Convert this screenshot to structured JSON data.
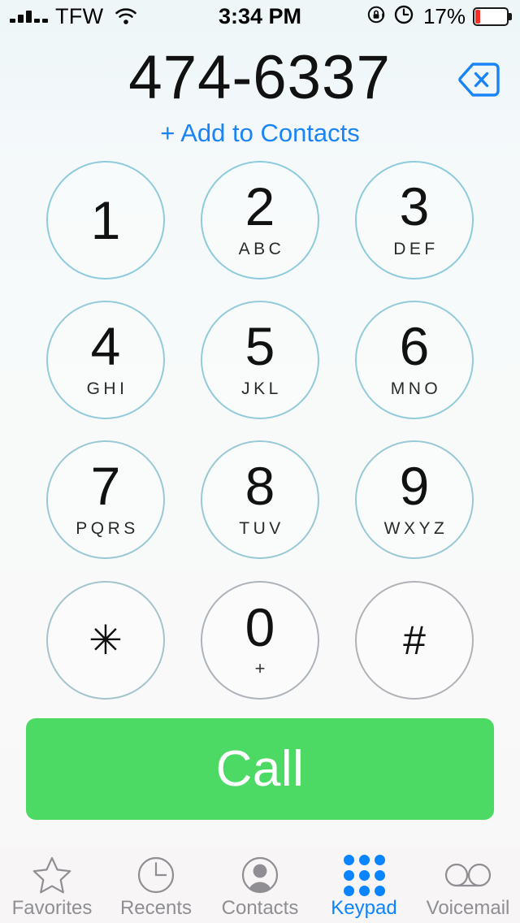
{
  "status_bar": {
    "carrier": "TFW",
    "signal_icon": "signal-bars-icon",
    "signal_bars_filled": 2,
    "signal_bars_total": 5,
    "wifi_icon": "wifi-icon",
    "time": "3:34 PM",
    "rotation_lock_icon": "rotation-lock-icon",
    "alarm_icon": "alarm-clock-icon",
    "battery_percent": "17%",
    "battery_level": 17,
    "battery_color": "#f52f23",
    "battery_icon": "battery-icon"
  },
  "display": {
    "phone_number": "474-6337",
    "add_to_contacts_label": "+ Add to Contacts",
    "add_to_contacts_color": "#1a84f7",
    "delete_icon": "delete-backspace-icon"
  },
  "keypad": {
    "rows": [
      [
        {
          "digit": "1",
          "letters": ""
        },
        {
          "digit": "2",
          "letters": "ABC"
        },
        {
          "digit": "3",
          "letters": "DEF"
        }
      ],
      [
        {
          "digit": "4",
          "letters": "GHI"
        },
        {
          "digit": "5",
          "letters": "JKL"
        },
        {
          "digit": "6",
          "letters": "MNO"
        }
      ],
      [
        {
          "digit": "7",
          "letters": "PQRS"
        },
        {
          "digit": "8",
          "letters": "TUV"
        },
        {
          "digit": "9",
          "letters": "WXYZ"
        }
      ],
      [
        {
          "digit": "✳",
          "letters": ""
        },
        {
          "digit": "0",
          "letters": "+"
        },
        {
          "digit": "#",
          "letters": ""
        }
      ]
    ]
  },
  "call_button": {
    "label": "Call",
    "color": "#4cd964"
  },
  "tab_bar": {
    "active_color": "#0b84ff",
    "inactive_color": "#8e8e93",
    "tabs": [
      {
        "label": "Favorites",
        "icon": "star-icon",
        "active": false
      },
      {
        "label": "Recents",
        "icon": "clock-icon",
        "active": false
      },
      {
        "label": "Contacts",
        "icon": "person-icon",
        "active": false
      },
      {
        "label": "Keypad",
        "icon": "keypad-grid-icon",
        "active": true
      },
      {
        "label": "Voicemail",
        "icon": "voicemail-icon",
        "active": false
      }
    ]
  }
}
